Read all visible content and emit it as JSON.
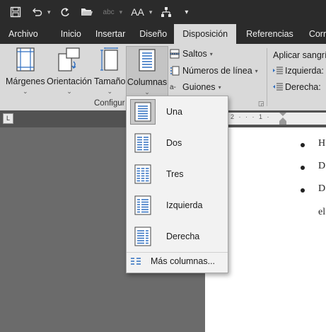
{
  "qat": {
    "icons": [
      "save-icon",
      "undo-icon",
      "redo-icon",
      "open-folder-icon",
      "spelling-icon",
      "text-direction-icon",
      "hierarchy-icon",
      "customize-icon"
    ]
  },
  "tabs": [
    {
      "label": "Archivo"
    },
    {
      "label": "Inicio"
    },
    {
      "label": "Insertar"
    },
    {
      "label": "Diseño"
    },
    {
      "label": "Disposición"
    },
    {
      "label": "Referencias"
    },
    {
      "label": "Corr"
    }
  ],
  "ribbon": {
    "margins": "Márgenes",
    "orientation": "Orientación",
    "size": "Tamaño",
    "columns": "Columnas",
    "breaks": "Saltos",
    "line_numbers": "Números de línea",
    "hyphenation": "Guiones",
    "group_label": "Configur",
    "indent_title": "Aplicar sangrí",
    "indent_left": "Izquierda:",
    "indent_right": "Derecha:"
  },
  "ruler": {
    "marks": "2 · · · 1 ·"
  },
  "document": {
    "bullets": [
      {
        "text": "H"
      },
      {
        "text": "D"
      },
      {
        "text": "D"
      }
    ],
    "continuation": "el"
  },
  "columns_menu": {
    "items": [
      {
        "label": "Una",
        "selected": true
      },
      {
        "label": "Dos",
        "selected": false
      },
      {
        "label": "Tres",
        "selected": false
      },
      {
        "label": "Izquierda",
        "selected": false
      },
      {
        "label": "Derecha",
        "selected": false
      }
    ],
    "more": "Más columnas..."
  },
  "colors": {
    "titlebar": "#2b2b2b",
    "ribbon": "#d9d9d9",
    "background": "#6b6b6b",
    "accent": "#2e6ec0"
  }
}
